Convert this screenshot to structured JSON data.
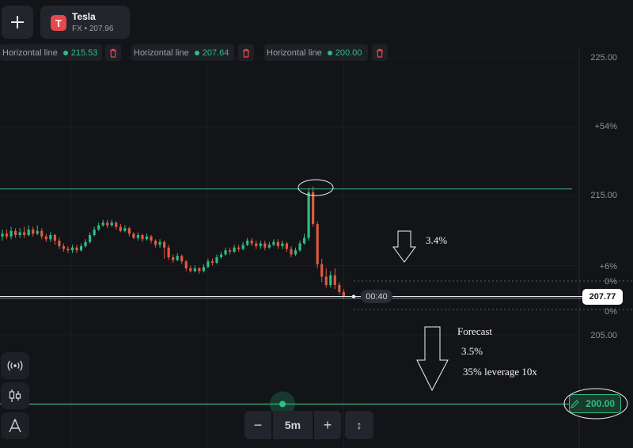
{
  "toolbar": {
    "add_label": "+"
  },
  "asset": {
    "name": "Tesla",
    "sub": "FX • 207.96",
    "logo": "T"
  },
  "horizontal_lines": [
    {
      "label": "Horizontal line",
      "value": "215.53"
    },
    {
      "label": "Horizontal line",
      "value": "207.64"
    },
    {
      "label": "Horizontal line",
      "value": "200.00"
    }
  ],
  "price_axis": {
    "labels": [
      "225.00",
      "+54%",
      "215.00",
      "+6%",
      "0%",
      "0%",
      "205.00"
    ],
    "current_price": "207.77",
    "line_price": "200.00"
  },
  "timer": "00:40",
  "zoom": {
    "minus": "−",
    "timeframe": "5m",
    "plus": "+",
    "extra": "↕"
  },
  "annotations": {
    "drop": "3.4%",
    "forecast_title": "Forecast",
    "forecast_pct": "3.5%",
    "forecast_note": "35% leverage 10x"
  },
  "colors": {
    "background": "#131418",
    "up": "#2ebd85",
    "down": "#e0593f",
    "accent": "#2ebd85"
  },
  "icons": [
    "plus-icon",
    "tesla-logo-icon",
    "trash-icon",
    "broadcast-icon",
    "candles-icon",
    "draw-tool-icon",
    "pencil-icon"
  ],
  "chart_data": {
    "type": "candlestick",
    "ylim": [
      198.0,
      226.0
    ],
    "candles": [
      {
        "o": 212.1,
        "c": 212.3,
        "h": 212.6,
        "l": 211.8
      },
      {
        "o": 212.3,
        "c": 212.1,
        "h": 212.6,
        "l": 211.9
      },
      {
        "o": 212.1,
        "c": 212.5,
        "h": 212.8,
        "l": 211.9
      },
      {
        "o": 212.5,
        "c": 212.2,
        "h": 212.7,
        "l": 212.0
      },
      {
        "o": 212.2,
        "c": 212.4,
        "h": 212.7,
        "l": 212.0
      },
      {
        "o": 212.4,
        "c": 212.2,
        "h": 212.8,
        "l": 212.0
      },
      {
        "o": 212.2,
        "c": 212.6,
        "h": 212.9,
        "l": 212.1
      },
      {
        "o": 212.6,
        "c": 212.3,
        "h": 212.8,
        "l": 212.1
      },
      {
        "o": 212.3,
        "c": 212.5,
        "h": 212.9,
        "l": 212.2
      },
      {
        "o": 212.5,
        "c": 212.1,
        "h": 212.7,
        "l": 211.9
      },
      {
        "o": 212.1,
        "c": 211.9,
        "h": 212.3,
        "l": 211.7
      },
      {
        "o": 211.9,
        "c": 212.2,
        "h": 212.4,
        "l": 211.7
      },
      {
        "o": 212.2,
        "c": 211.8,
        "h": 212.3,
        "l": 211.5
      },
      {
        "o": 211.8,
        "c": 211.4,
        "h": 212.0,
        "l": 211.2
      },
      {
        "o": 211.4,
        "c": 211.2,
        "h": 211.6,
        "l": 211.0
      },
      {
        "o": 211.2,
        "c": 211.1,
        "h": 211.4,
        "l": 210.9
      },
      {
        "o": 211.1,
        "c": 211.3,
        "h": 211.5,
        "l": 210.9
      },
      {
        "o": 211.3,
        "c": 211.1,
        "h": 211.5,
        "l": 210.9
      },
      {
        "o": 211.1,
        "c": 211.4,
        "h": 211.6,
        "l": 211.0
      },
      {
        "o": 211.4,
        "c": 211.7,
        "h": 211.9,
        "l": 211.3
      },
      {
        "o": 211.7,
        "c": 212.2,
        "h": 212.4,
        "l": 211.6
      },
      {
        "o": 212.2,
        "c": 212.6,
        "h": 212.8,
        "l": 212.1
      },
      {
        "o": 212.6,
        "c": 212.9,
        "h": 213.1,
        "l": 212.5
      },
      {
        "o": 212.9,
        "c": 213.1,
        "h": 213.3,
        "l": 212.8
      },
      {
        "o": 213.1,
        "c": 212.9,
        "h": 213.3,
        "l": 212.7
      },
      {
        "o": 212.9,
        "c": 213.1,
        "h": 213.3,
        "l": 212.8
      },
      {
        "o": 213.1,
        "c": 212.8,
        "h": 213.2,
        "l": 212.6
      },
      {
        "o": 212.8,
        "c": 212.5,
        "h": 213.0,
        "l": 212.4
      },
      {
        "o": 212.5,
        "c": 212.7,
        "h": 212.9,
        "l": 212.4
      },
      {
        "o": 212.7,
        "c": 212.3,
        "h": 212.8,
        "l": 212.1
      },
      {
        "o": 212.3,
        "c": 212.0,
        "h": 212.4,
        "l": 211.9
      },
      {
        "o": 212.0,
        "c": 212.2,
        "h": 212.4,
        "l": 211.8
      },
      {
        "o": 212.2,
        "c": 211.9,
        "h": 212.3,
        "l": 211.7
      },
      {
        "o": 211.9,
        "c": 212.1,
        "h": 212.3,
        "l": 211.8
      },
      {
        "o": 212.1,
        "c": 211.8,
        "h": 212.2,
        "l": 211.6
      },
      {
        "o": 211.8,
        "c": 211.5,
        "h": 211.9,
        "l": 211.3
      },
      {
        "o": 211.5,
        "c": 211.7,
        "h": 211.9,
        "l": 211.3
      },
      {
        "o": 211.7,
        "c": 211.3,
        "h": 211.8,
        "l": 210.5
      },
      {
        "o": 211.3,
        "c": 210.6,
        "h": 211.5,
        "l": 210.4
      },
      {
        "o": 210.6,
        "c": 210.4,
        "h": 210.8,
        "l": 210.2
      },
      {
        "o": 210.4,
        "c": 210.7,
        "h": 210.9,
        "l": 210.3
      },
      {
        "o": 210.7,
        "c": 210.3,
        "h": 210.8,
        "l": 210.1
      },
      {
        "o": 210.3,
        "c": 209.8,
        "h": 210.4,
        "l": 209.6
      },
      {
        "o": 209.8,
        "c": 209.6,
        "h": 210.0,
        "l": 209.5
      },
      {
        "o": 209.6,
        "c": 209.8,
        "h": 210.0,
        "l": 209.5
      },
      {
        "o": 209.8,
        "c": 209.6,
        "h": 209.9,
        "l": 209.4
      },
      {
        "o": 209.6,
        "c": 209.9,
        "h": 210.1,
        "l": 209.5
      },
      {
        "o": 209.9,
        "c": 210.3,
        "h": 210.5,
        "l": 209.8
      },
      {
        "o": 210.3,
        "c": 210.2,
        "h": 210.5,
        "l": 210.0
      },
      {
        "o": 210.2,
        "c": 210.6,
        "h": 210.8,
        "l": 210.1
      },
      {
        "o": 210.6,
        "c": 210.8,
        "h": 211.0,
        "l": 210.5
      },
      {
        "o": 210.8,
        "c": 211.1,
        "h": 211.3,
        "l": 210.7
      },
      {
        "o": 211.1,
        "c": 211.0,
        "h": 211.3,
        "l": 210.8
      },
      {
        "o": 211.0,
        "c": 211.3,
        "h": 211.5,
        "l": 210.9
      },
      {
        "o": 211.3,
        "c": 211.2,
        "h": 211.5,
        "l": 211.0
      },
      {
        "o": 211.2,
        "c": 211.5,
        "h": 211.7,
        "l": 211.1
      },
      {
        "o": 211.5,
        "c": 211.8,
        "h": 212.0,
        "l": 211.4
      },
      {
        "o": 211.8,
        "c": 211.6,
        "h": 212.0,
        "l": 211.4
      },
      {
        "o": 211.6,
        "c": 211.4,
        "h": 211.8,
        "l": 211.2
      },
      {
        "o": 211.4,
        "c": 211.6,
        "h": 211.8,
        "l": 211.2
      },
      {
        "o": 211.6,
        "c": 211.3,
        "h": 211.8,
        "l": 211.1
      },
      {
        "o": 211.3,
        "c": 211.5,
        "h": 211.7,
        "l": 211.2
      },
      {
        "o": 211.5,
        "c": 211.7,
        "h": 211.9,
        "l": 211.4
      },
      {
        "o": 211.7,
        "c": 211.4,
        "h": 211.9,
        "l": 211.2
      },
      {
        "o": 211.4,
        "c": 211.6,
        "h": 211.8,
        "l": 211.2
      },
      {
        "o": 211.6,
        "c": 211.2,
        "h": 211.7,
        "l": 211.0
      },
      {
        "o": 211.2,
        "c": 210.8,
        "h": 211.4,
        "l": 210.6
      },
      {
        "o": 210.8,
        "c": 211.1,
        "h": 211.3,
        "l": 210.7
      },
      {
        "o": 211.1,
        "c": 211.6,
        "h": 211.8,
        "l": 211.0
      },
      {
        "o": 211.6,
        "c": 212.0,
        "h": 212.3,
        "l": 211.5
      },
      {
        "o": 212.0,
        "c": 215.3,
        "h": 215.6,
        "l": 211.8
      },
      {
        "o": 215.3,
        "c": 213.0,
        "h": 215.7,
        "l": 212.8
      },
      {
        "o": 213.0,
        "c": 210.1,
        "h": 213.2,
        "l": 209.8
      },
      {
        "o": 210.1,
        "c": 209.2,
        "h": 210.5,
        "l": 208.8
      },
      {
        "o": 209.2,
        "c": 208.6,
        "h": 209.8,
        "l": 208.4
      },
      {
        "o": 208.6,
        "c": 209.3,
        "h": 209.6,
        "l": 208.4
      },
      {
        "o": 209.3,
        "c": 208.6,
        "h": 209.8,
        "l": 208.3
      },
      {
        "o": 208.6,
        "c": 208.1,
        "h": 208.8,
        "l": 207.9
      },
      {
        "o": 208.1,
        "c": 207.8,
        "h": 208.3,
        "l": 207.6
      }
    ]
  }
}
